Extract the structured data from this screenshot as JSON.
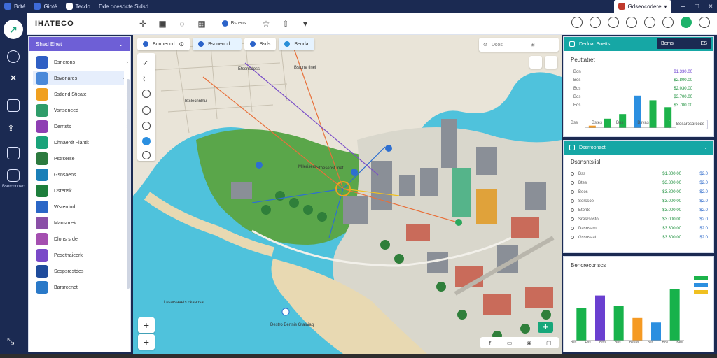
{
  "os": {
    "tabs": [
      {
        "label": "Bdté"
      },
      {
        "label": "Gioté"
      },
      {
        "label": "Tecdo"
      },
      {
        "label": "Dde dcesdcte Sidsd"
      }
    ],
    "active_tab": "Gdseocodere",
    "controls": [
      "–",
      "□",
      "×"
    ]
  },
  "toolbar": {
    "brand": "IHATECO",
    "chip_label": "Bsrens"
  },
  "sidebar": {
    "title": "Shed Ehet",
    "items": [
      {
        "label": "Dsnerons",
        "color": "#2f5fc4"
      },
      {
        "label": "Bsvonares",
        "color": "#4b89d9"
      },
      {
        "label": "Sstlend Sticate",
        "color": "#f0a020"
      },
      {
        "label": "Vsnseneed",
        "color": "#2f9d6a"
      },
      {
        "label": "Derrtsts",
        "color": "#8e3fb3"
      },
      {
        "label": "Dhnaerdt Fiantit",
        "color": "#1aa37a"
      },
      {
        "label": "Pstrserse",
        "color": "#2c7a3e"
      },
      {
        "label": "Gsnsaens",
        "color": "#1a7fb8"
      },
      {
        "label": "Dsrensk",
        "color": "#1d7e3c"
      },
      {
        "label": "Wsrerdod",
        "color": "#2a66c6"
      },
      {
        "label": "Mansrrrek",
        "color": "#8a4fa7"
      },
      {
        "label": "Dlonsrsrde",
        "color": "#a44fb0"
      },
      {
        "label": "Pesetnaieerk",
        "color": "#7a49c8"
      },
      {
        "label": "Sespsrestdes",
        "color": "#1f4c9c"
      },
      {
        "label": "Barsrcenet",
        "color": "#2a79c8"
      }
    ],
    "rail_label": "Bserconnect"
  },
  "map": {
    "tabs": [
      {
        "label": "Bonnencd"
      },
      {
        "label": "Bsnnencd"
      },
      {
        "label": "Bsds"
      },
      {
        "label": "Benda"
      }
    ],
    "search_placeholder": "Dsos",
    "labels": [
      {
        "text": "Etsensdoss"
      },
      {
        "text": "Bsfone tinei"
      },
      {
        "text": "Btclecnnlnu"
      },
      {
        "text": "Mllerisers"
      },
      {
        "text": "Sthesenst Inet"
      },
      {
        "text": "Lesarsaaets ckaansa"
      },
      {
        "text": "Destro Bertnis Gtalaiag"
      }
    ],
    "zoom_in": "+",
    "zoom_out": "+"
  },
  "panels": {
    "top": {
      "header": "Dedoat Soetts",
      "dark_tab": "Bems",
      "dark_tab_badge": "ES",
      "title": "Peuttatret",
      "rows": [
        {
          "k": "Bon",
          "v": "$1.330.00"
        },
        {
          "k": "Bos",
          "v": "$2.800.00"
        },
        {
          "k": "Bos",
          "v": "$2.030.00"
        },
        {
          "k": "Bos",
          "v": "$3.700.00"
        },
        {
          "k": "Eos",
          "v": "$3.700.00"
        }
      ],
      "axis": [
        "Bss",
        "Bstes",
        "Bns",
        "Bsvas"
      ],
      "footer": "Bosarosorceds"
    },
    "mid": {
      "header": "Dssrroonact",
      "title": "Dssnsntsiisl",
      "rows": [
        {
          "k": "Bss",
          "v": "$1.800.00",
          "v2": "$2.0"
        },
        {
          "k": "Btes",
          "v": "$3.800.00",
          "v2": "$2.0"
        },
        {
          "k": "Beos",
          "v": "$3.800.00",
          "v2": "$2.0"
        },
        {
          "k": "Sorssoe",
          "v": "$3.000.00",
          "v2": "$2.0"
        },
        {
          "k": "Etonte",
          "v": "$3.000.00",
          "v2": "$2.0"
        },
        {
          "k": "Sresrsosto",
          "v": "$3.000.00",
          "v2": "$2.0"
        },
        {
          "k": "Dasnsarn",
          "v": "$3.300.00",
          "v2": "$2.0"
        },
        {
          "k": "Gssosaat",
          "v": "$3.300.00",
          "v2": "$2.0"
        }
      ]
    },
    "bottom": {
      "title": "Bencrecoriscs",
      "axis": [
        "Bss",
        "Ess",
        "Btss",
        "Bns",
        "Bsvas",
        "Bes",
        "Bos",
        "Bes"
      ]
    }
  },
  "chart_data": [
    {
      "type": "bar",
      "title": "Peuttatret",
      "categories": [
        "1",
        "2",
        "3",
        "4",
        "5",
        "6"
      ],
      "values": [
        5,
        20,
        30,
        70,
        60,
        45
      ],
      "colors": [
        "#f59a23",
        "#1cb34a",
        "#1cb34a",
        "#2b8fe0",
        "#1cb34a",
        "#1cb34a"
      ]
    },
    {
      "type": "bar",
      "title": "Bencrecoriscs",
      "categories": [
        "1",
        "2",
        "3",
        "4",
        "5",
        "6"
      ],
      "values": [
        50,
        70,
        54,
        35,
        28,
        80
      ],
      "colors": [
        "#17b24b",
        "#6a3fd0",
        "#17b24b",
        "#f59a23",
        "#2b8fe0",
        "#17b24b"
      ]
    }
  ]
}
